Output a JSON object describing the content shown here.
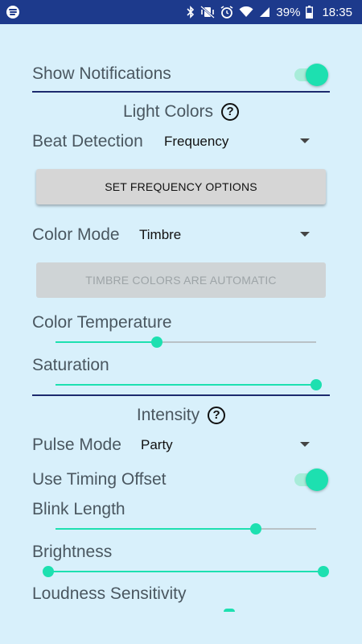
{
  "status_bar": {
    "battery": "39%",
    "time": "18:35",
    "icons": [
      "spotify-icon",
      "bluetooth-icon",
      "vibrate-icon",
      "alarm-icon",
      "wifi-icon",
      "signal-icon",
      "battery-icon"
    ]
  },
  "colors": {
    "status_bar": "#1d3a8c",
    "background": "#d8f0fb",
    "accent": "#1de0b0",
    "divider": "#1c2a6e"
  },
  "notifications": {
    "label": "Show Notifications",
    "enabled": true
  },
  "light_colors": {
    "title": "Light Colors",
    "help_glyph": "?",
    "beat_detection": {
      "label": "Beat Detection",
      "value": "Frequency"
    },
    "set_frequency_button": "SET FREQUENCY OPTIONS",
    "color_mode": {
      "label": "Color Mode",
      "value": "Timbre"
    },
    "timbre_button": "TIMBRE COLORS ARE AUTOMATIC",
    "color_temperature": {
      "label": "Color Temperature",
      "level": 0.39
    },
    "saturation": {
      "label": "Saturation",
      "level": 1.0
    }
  },
  "intensity": {
    "title": "Intensity",
    "help_glyph": "?",
    "pulse_mode": {
      "label": "Pulse Mode",
      "value": "Party"
    },
    "timing_offset": {
      "label": "Use Timing Offset",
      "enabled": true
    },
    "blink_length": {
      "label": "Blink Length",
      "level": 0.77
    },
    "brightness": {
      "label": "Brightness",
      "range": [
        0.0,
        1.0
      ]
    },
    "loudness_sensitivity": {
      "label": "Loudness Sensitivity"
    }
  }
}
